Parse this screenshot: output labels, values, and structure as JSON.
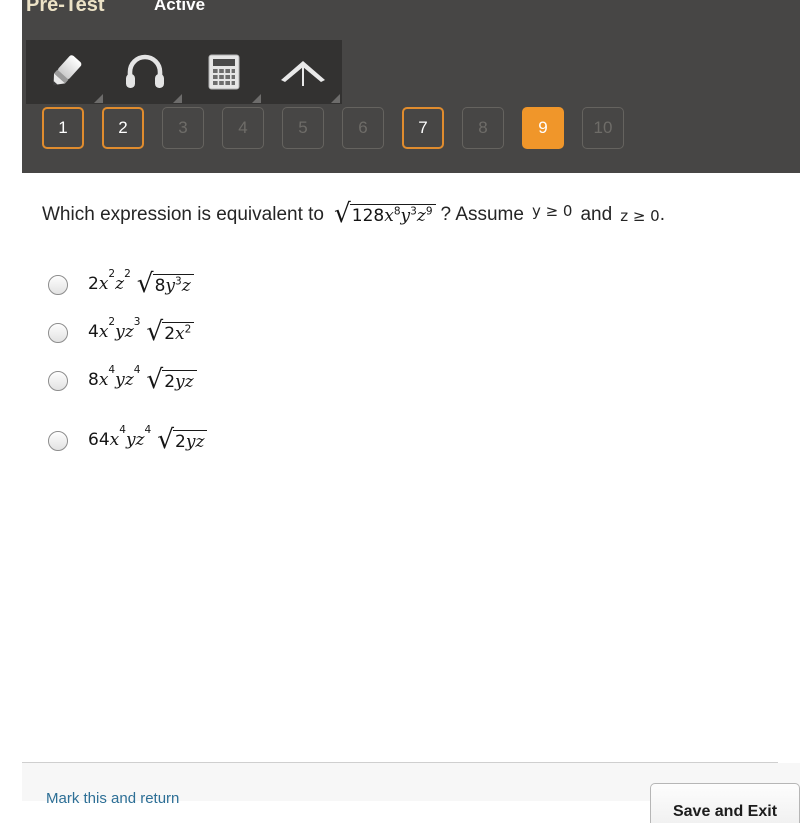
{
  "header": {
    "test_title": "Pre-Test",
    "status": "Active",
    "background_color": "#474645",
    "title_color": "#ece2c6",
    "accent_color": "#f0962a"
  },
  "toolbar": {
    "tools": [
      {
        "name": "highlighter-icon",
        "label": "Highlighter"
      },
      {
        "name": "headphones-icon",
        "label": "Audio"
      },
      {
        "name": "calculator-icon",
        "label": "Calculator"
      },
      {
        "name": "protractor-icon",
        "label": "Protractor"
      }
    ]
  },
  "question_nav": {
    "items": [
      {
        "number": "1",
        "state": "answered"
      },
      {
        "number": "2",
        "state": "answered"
      },
      {
        "number": "3",
        "state": "unanswered"
      },
      {
        "number": "4",
        "state": "unanswered"
      },
      {
        "number": "5",
        "state": "unanswered"
      },
      {
        "number": "6",
        "state": "unanswered"
      },
      {
        "number": "7",
        "state": "answered"
      },
      {
        "number": "8",
        "state": "unanswered"
      },
      {
        "number": "9",
        "state": "current"
      },
      {
        "number": "10",
        "state": "unanswered"
      }
    ]
  },
  "question": {
    "prompt_prefix": "Which expression is equivalent to",
    "radicand": {
      "coefficient": "128",
      "terms": [
        {
          "base": "x",
          "exponent": "8"
        },
        {
          "base": "y",
          "exponent": "3"
        },
        {
          "base": "z",
          "exponent": "9"
        }
      ],
      "plain": "128x^8 y^3 z^9"
    },
    "prompt_middle": "? Assume",
    "condition_1": "y ≥ 0",
    "conjunction": "and",
    "condition_2": "z ≥ 0",
    "terminator": ".",
    "full_text": "Which expression is equivalent to √(128x⁸y³z⁹)? Assume y ≥ 0 and z ≥ 0."
  },
  "choices": [
    {
      "id": "choice-a",
      "selected": false,
      "coefficient": "2",
      "outside": [
        {
          "base": "x",
          "exponent": "2"
        },
        {
          "base": "z",
          "exponent": "2"
        }
      ],
      "inside_coefficient": "8",
      "inside": [
        {
          "base": "y",
          "exponent": "3"
        },
        {
          "base": "z",
          "exponent": ""
        }
      ],
      "plain": "2x^2 z^2 √(8y^3 z)"
    },
    {
      "id": "choice-b",
      "selected": false,
      "coefficient": "4",
      "outside": [
        {
          "base": "x",
          "exponent": "2"
        },
        {
          "base": "y",
          "exponent": ""
        },
        {
          "base": "z",
          "exponent": "3"
        }
      ],
      "inside_coefficient": "2",
      "inside": [
        {
          "base": "x",
          "exponent": "2"
        }
      ],
      "plain": "4x^2 yz^3 √(2x^2)"
    },
    {
      "id": "choice-c",
      "selected": false,
      "coefficient": "8",
      "outside": [
        {
          "base": "x",
          "exponent": "4"
        },
        {
          "base": "y",
          "exponent": ""
        },
        {
          "base": "z",
          "exponent": "4"
        }
      ],
      "inside_coefficient": "2",
      "inside": [
        {
          "base": "y",
          "exponent": ""
        },
        {
          "base": "z",
          "exponent": ""
        }
      ],
      "plain": "8x^4 yz^4 √(2yz)"
    },
    {
      "id": "choice-d",
      "selected": false,
      "coefficient": "64",
      "outside": [
        {
          "base": "x",
          "exponent": "4"
        },
        {
          "base": "y",
          "exponent": ""
        },
        {
          "base": "z",
          "exponent": "4"
        }
      ],
      "inside_coefficient": "2",
      "inside": [
        {
          "base": "y",
          "exponent": ""
        },
        {
          "base": "z",
          "exponent": ""
        }
      ],
      "plain": "64x^4 yz^4 √(2yz)"
    }
  ],
  "footer": {
    "mark_return_label": "Mark this and return",
    "save_exit_label": "Save and Exit",
    "link_color": "#2d6f96"
  }
}
